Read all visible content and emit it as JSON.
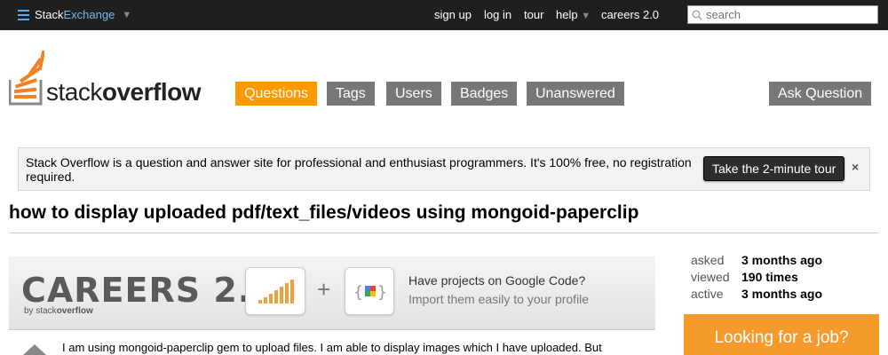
{
  "topbar": {
    "brand_stack": "Stack",
    "brand_exchange": "Exchange",
    "links": {
      "signup": "sign up",
      "login": "log in",
      "tour": "tour",
      "help": "help",
      "careers": "careers 2.0"
    },
    "search_placeholder": "search"
  },
  "logo": {
    "stack": "stack",
    "overflow": "overflow"
  },
  "nav": {
    "questions": "Questions",
    "tags": "Tags",
    "users": "Users",
    "badges": "Badges",
    "unanswered": "Unanswered",
    "ask": "Ask Question"
  },
  "notice": {
    "text": "Stack Overflow is a question and answer site for professional and enthusiast programmers. It's 100% free, no registration required.",
    "tour_button": "Take the 2-minute tour",
    "close": "×"
  },
  "question": {
    "title": "how to display uploaded pdf/text_files/videos using mongoid-paperclip",
    "body_first_line": "I am using mongoid-paperclip gem to upload files. I am able to display images which I have uploaded. But"
  },
  "careers_banner": {
    "logo": "CAREERS 2.0",
    "by": "by",
    "by_stack": "stack",
    "by_overflow": "overflow",
    "plus": "+",
    "headline": "Have projects on Google Code?",
    "subline": "Import them easily to your profile"
  },
  "stats": {
    "asked_label": "asked",
    "asked_value": "3 months ago",
    "viewed_label": "viewed",
    "viewed_value": "190 times",
    "active_label": "active",
    "active_value": "3 months ago"
  },
  "job_box": {
    "text": "Looking for a job?"
  },
  "colors": {
    "topbar": "#1f1f1f",
    "nav_active": "#ff9900",
    "nav_default": "#777777",
    "job_box": "#f79a2c"
  }
}
